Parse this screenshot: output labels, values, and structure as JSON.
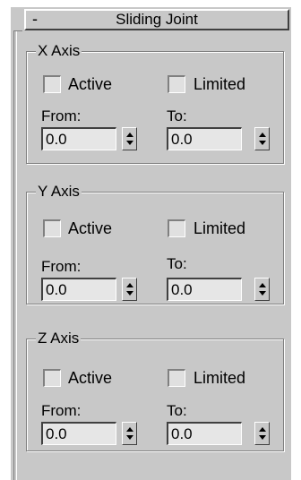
{
  "rollout": {
    "collapse_symbol": "-",
    "title": "Sliding Joint"
  },
  "axes": [
    {
      "legend": "X Axis",
      "active_label": "Active",
      "limited_label": "Limited",
      "from_label": "From:",
      "to_label": "To:",
      "from_value": "0.0",
      "to_value": "0.0"
    },
    {
      "legend": "Y Axis",
      "active_label": "Active",
      "limited_label": "Limited",
      "from_label": "From:",
      "to_label": "To:",
      "from_value": "0.0",
      "to_value": "0.0"
    },
    {
      "legend": "Z Axis",
      "active_label": "Active",
      "limited_label": "Limited",
      "from_label": "From:",
      "to_label": "To:",
      "from_value": "0.0",
      "to_value": "0.0"
    }
  ]
}
